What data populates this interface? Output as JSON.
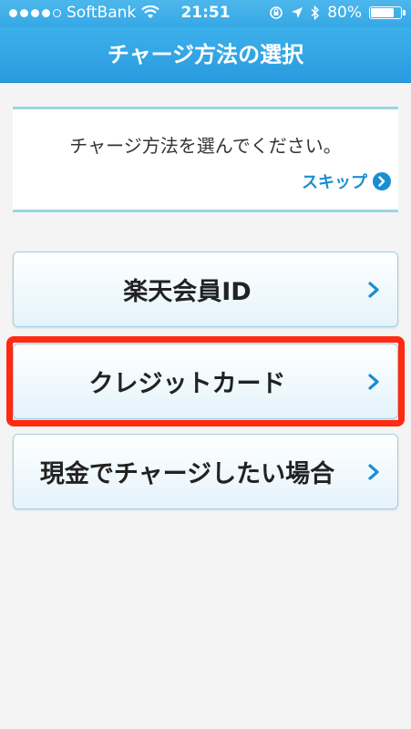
{
  "status_bar": {
    "carrier": "SoftBank",
    "time": "21:51",
    "battery": "80%",
    "battery_level": 0.8
  },
  "nav": {
    "title": "チャージ方法の選択"
  },
  "info": {
    "message": "チャージ方法を選んでください。",
    "skip_label": "スキップ"
  },
  "options": [
    {
      "label": "楽天会員ID"
    },
    {
      "label": "クレジットカード"
    },
    {
      "label": "現金でチャージしたい場合"
    }
  ],
  "colors": {
    "accent": "#2a9be0",
    "link": "#1a8ed2",
    "highlight": "#ff2a12"
  }
}
